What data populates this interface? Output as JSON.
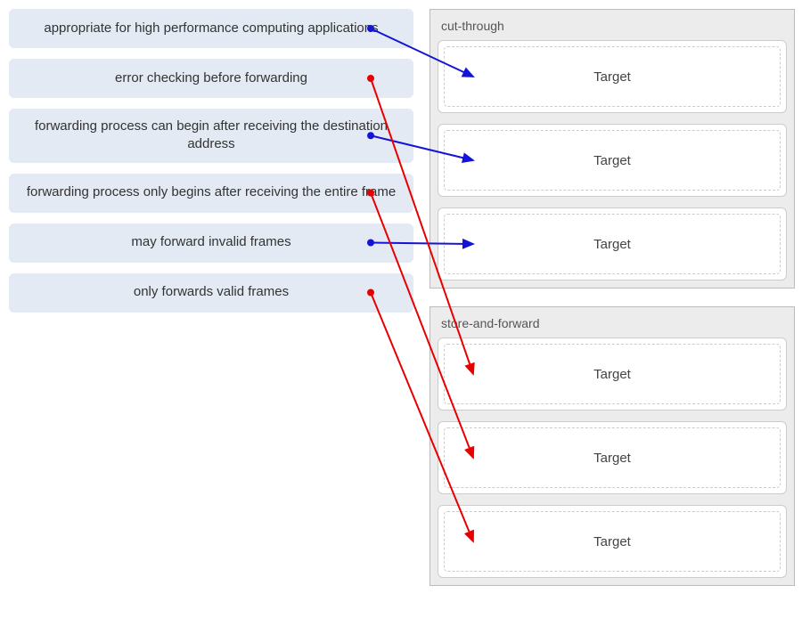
{
  "sources": [
    {
      "id": "src-hpc",
      "label": "appropriate for high performance computing applications"
    },
    {
      "id": "src-errchk",
      "label": "error checking before forwarding"
    },
    {
      "id": "src-destaddr",
      "label": "forwarding process can begin after receiving the destination address"
    },
    {
      "id": "src-entireframe",
      "label": "forwarding process only begins after receiving the entire frame"
    },
    {
      "id": "src-invalid",
      "label": "may forward invalid frames"
    },
    {
      "id": "src-valid",
      "label": "only forwards valid frames"
    }
  ],
  "groups": [
    {
      "id": "grp-cut",
      "title": "cut-through",
      "targets": [
        "Target",
        "Target",
        "Target"
      ]
    },
    {
      "id": "grp-store",
      "title": "store-and-forward",
      "targets": [
        "Target",
        "Target",
        "Target"
      ]
    }
  ],
  "arrows": [
    {
      "from": "src-hpc",
      "to_group": "grp-cut",
      "to_index": 0,
      "color": "#1414d8"
    },
    {
      "from": "src-destaddr",
      "to_group": "grp-cut",
      "to_index": 1,
      "color": "#1414d8"
    },
    {
      "from": "src-invalid",
      "to_group": "grp-cut",
      "to_index": 2,
      "color": "#1414d8"
    },
    {
      "from": "src-errchk",
      "to_group": "grp-store",
      "to_index": 0,
      "color": "#e80000"
    },
    {
      "from": "src-entireframe",
      "to_group": "grp-store",
      "to_index": 1,
      "color": "#e80000"
    },
    {
      "from": "src-valid",
      "to_group": "grp-store",
      "to_index": 2,
      "color": "#e80000"
    }
  ]
}
